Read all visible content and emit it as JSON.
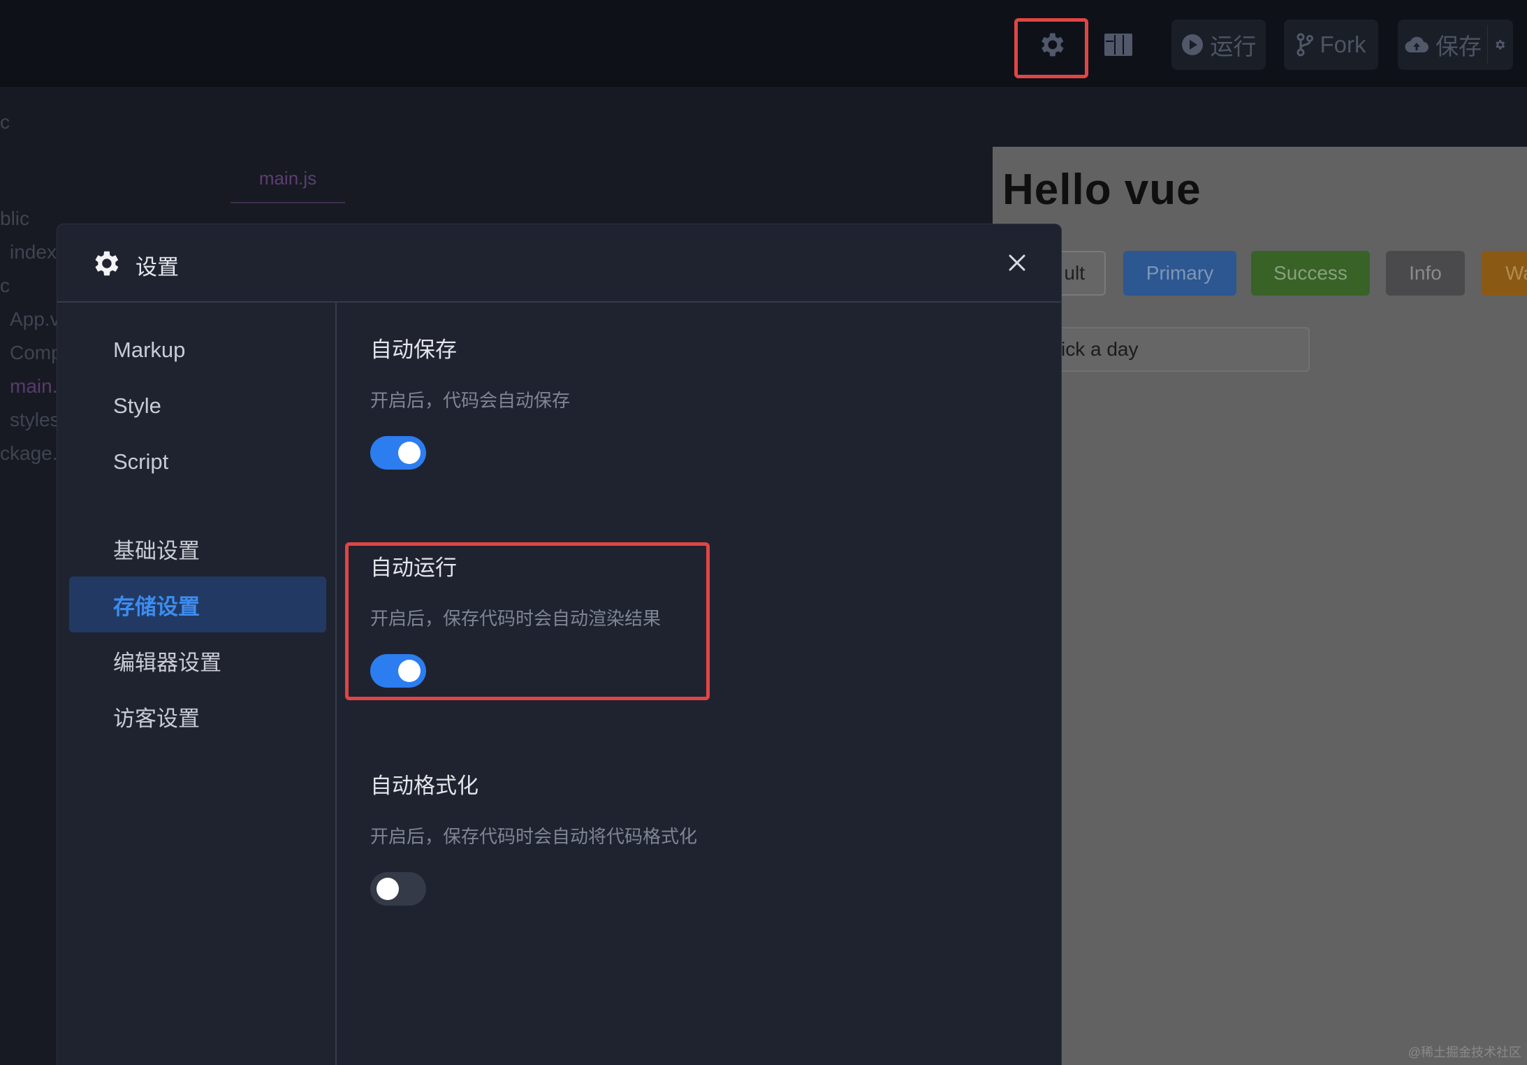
{
  "topbar": {
    "run_label": "运行",
    "fork_label": "Fork",
    "save_label": "保存"
  },
  "filetree": {
    "items": [
      {
        "label": "blic"
      },
      {
        "label": "index"
      },
      {
        "label": "c"
      },
      {
        "label": "App.v"
      },
      {
        "label": "Comp"
      },
      {
        "label": "main."
      },
      {
        "label": "styles"
      },
      {
        "label": "ckage."
      }
    ],
    "top_fragment": "c"
  },
  "editor": {
    "active_tab": "main.js"
  },
  "preview": {
    "heading": "Hello vue",
    "buttons": {
      "default": "ult",
      "primary": "Primary",
      "success": "Success",
      "info": "Info",
      "warning": "Wa"
    },
    "date_placeholder": "ick a day"
  },
  "modal": {
    "title": "设置",
    "sidebar": {
      "items": [
        {
          "label": "Markup"
        },
        {
          "label": "Style"
        },
        {
          "label": "Script"
        },
        {
          "label": "基础设置"
        },
        {
          "label": "存储设置"
        },
        {
          "label": "编辑器设置"
        },
        {
          "label": "访客设置"
        }
      ]
    },
    "sections": [
      {
        "title": "自动保存",
        "desc": "开启后，代码会自动保存",
        "enabled": true
      },
      {
        "title": "自动运行",
        "desc": "开启后，保存代码时会自动渲染结果",
        "enabled": true
      },
      {
        "title": "自动格式化",
        "desc": "开启后，保存代码时会自动将代码格式化",
        "enabled": false
      }
    ]
  },
  "colors": {
    "accent": "#2b7df0",
    "highlight": "#e04545",
    "modal_bg": "#1f2330",
    "active_item_bg": "#223a63"
  },
  "watermark": "@稀土掘金技术社区"
}
